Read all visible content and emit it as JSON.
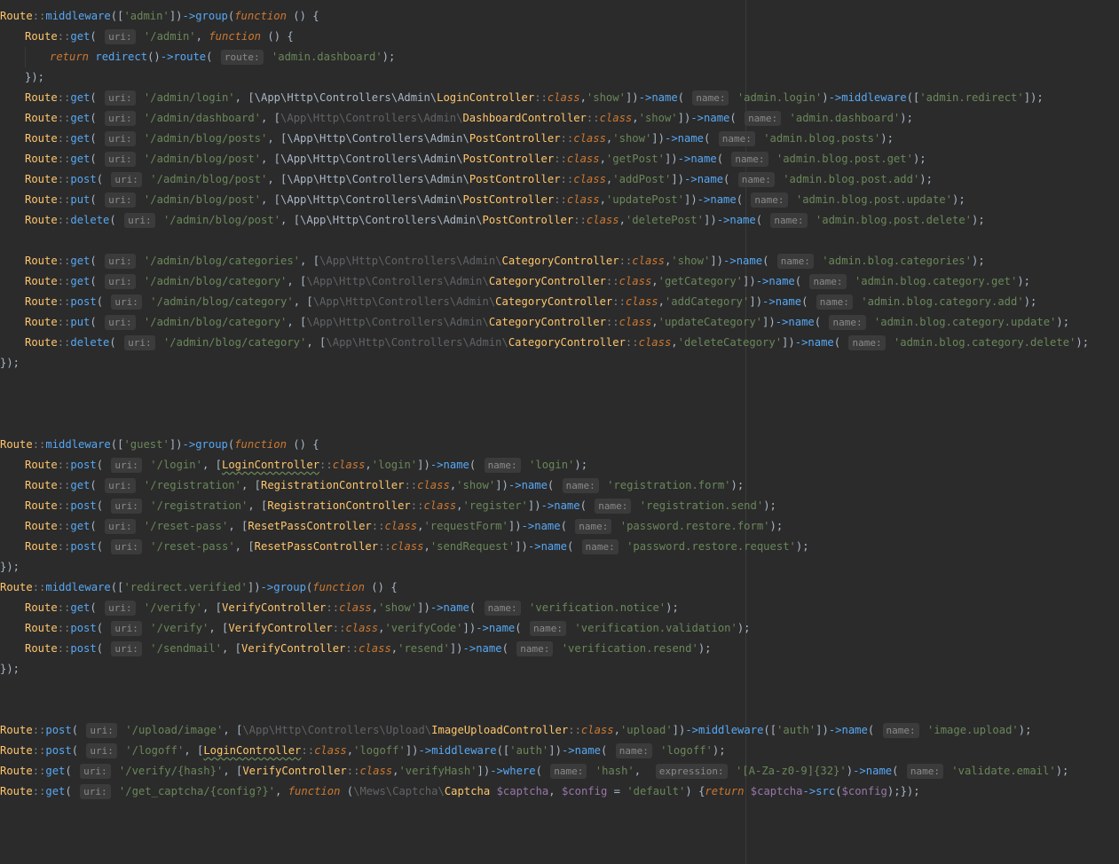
{
  "editor": {
    "language": "php",
    "lines": [
      "Route::middleware(['admin'])->group(function () {",
      "    Route::get( uri: '/admin', function () {",
      "        return redirect()->route( route: 'admin.dashboard');",
      "    });",
      "    Route::get( uri: '/admin/login', [\\App\\Http\\Controllers\\Admin\\LoginController::class,'show'])->name( name: 'admin.login')->middleware(['admin.redirect']);",
      "    Route::get( uri: '/admin/dashboard', [\\App\\Http\\Controllers\\Admin\\DashboardController::class,'show'])->name( name: 'admin.dashboard');",
      "    Route::get( uri: '/admin/blog/posts', [\\App\\Http\\Controllers\\Admin\\PostController::class,'show'])->name( name: 'admin.blog.posts');",
      "    Route::get( uri: '/admin/blog/post', [\\App\\Http\\Controllers\\Admin\\PostController::class,'getPost'])->name( name: 'admin.blog.post.get');",
      "    Route::post( uri: '/admin/blog/post', [\\App\\Http\\Controllers\\Admin\\PostController::class,'addPost'])->name( name: 'admin.blog.post.add');",
      "    Route::put( uri: '/admin/blog/post', [\\App\\Http\\Controllers\\Admin\\PostController::class,'updatePost'])->name( name: 'admin.blog.post.update');",
      "    Route::delete( uri: '/admin/blog/post', [\\App\\Http\\Controllers\\Admin\\PostController::class,'deletePost'])->name( name: 'admin.blog.post.delete');",
      "",
      "    Route::get( uri: '/admin/blog/categories', [\\App\\Http\\Controllers\\Admin\\CategoryController::class,'show'])->name( name: 'admin.blog.categories');",
      "    Route::get( uri: '/admin/blog/category', [\\App\\Http\\Controllers\\Admin\\CategoryController::class,'getCategory'])->name( name: 'admin.blog.category.get');",
      "    Route::post( uri: '/admin/blog/category', [\\App\\Http\\Controllers\\Admin\\CategoryController::class,'addCategory'])->name( name: 'admin.blog.category.add');",
      "    Route::put( uri: '/admin/blog/category', [\\App\\Http\\Controllers\\Admin\\CategoryController::class,'updateCategory'])->name( name: 'admin.blog.category.update');",
      "    Route::delete( uri: '/admin/blog/category', [\\App\\Http\\Controllers\\Admin\\CategoryController::class,'deleteCategory'])->name( name: 'admin.blog.category.delete');",
      "});",
      "",
      "",
      "",
      "Route::middleware(['guest'])->group(function () {",
      "    Route::post( uri: '/login', [LoginController::class,'login'])->name( name: 'login');",
      "    Route::get( uri: '/registration', [RegistrationController::class,'show'])->name( name: 'registration.form');",
      "    Route::post( uri: '/registration', [RegistrationController::class,'register'])->name( name: 'registration.send');",
      "    Route::get( uri: '/reset-pass', [ResetPassController::class,'requestForm'])->name( name: 'password.restore.form');",
      "    Route::post( uri: '/reset-pass', [ResetPassController::class,'sendRequest'])->name( name: 'password.restore.request');",
      "});",
      "Route::middleware(['redirect.verified'])->group(function () {",
      "    Route::get( uri: '/verify', [VerifyController::class,'show'])->name( name: 'verification.notice');",
      "    Route::post( uri: '/verify', [VerifyController::class,'verifyCode'])->name( name: 'verification.validation');",
      "    Route::post( uri: '/sendmail', [VerifyController::class,'resend'])->name( name: 'verification.resend');",
      "});",
      "",
      "",
      "Route::post( uri: '/upload/image', [\\App\\Http\\Controllers\\Upload\\ImageUploadController::class,'upload'])->middleware(['auth'])->name( name: 'image.upload');",
      "Route::post( uri: '/logoff', [LoginController::class,'logoff'])->middleware(['auth'])->name( name: 'logoff');",
      "Route::get( uri: '/verify/{hash}', [VerifyController::class,'verifyHash'])->where( name: 'hash',  expression: '[A-Za-z0-9]{32}')->name( name: 'validate.email');",
      "Route::get( uri: '/get_captcha/{config?}', function (\\Mews\\Captcha\\Captcha $captcha, $config = 'default') {return $captcha->src($config);});"
    ]
  }
}
